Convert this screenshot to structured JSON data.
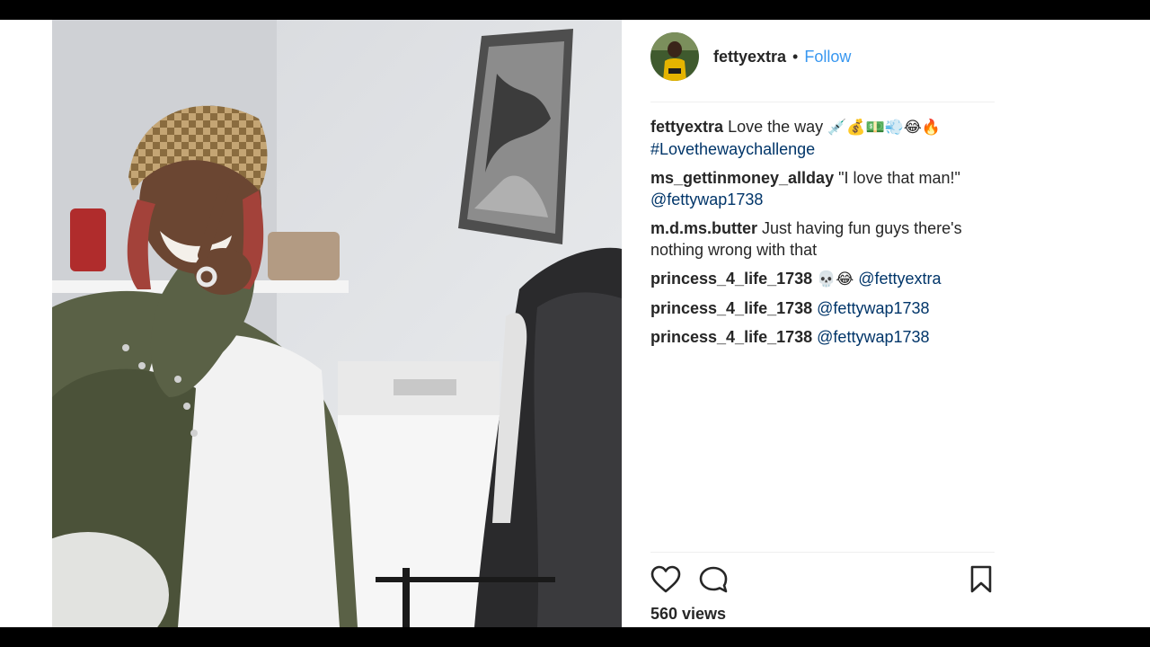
{
  "post": {
    "username": "fettyextra",
    "separator": "•",
    "follow_label": "Follow",
    "views": "560 views"
  },
  "comments": [
    {
      "user": "fettyextra",
      "text": "Love the way",
      "emoji": "💉💰💵💨😂🔥",
      "link": "#Lovethewaychallenge"
    },
    {
      "user": "ms_gettinmoney_allday",
      "text": "\"I love that man!\"",
      "link": "@fettywap1738"
    },
    {
      "user": "m.d.ms.butter",
      "text": "Just having fun guys there's nothing wrong with that"
    },
    {
      "user": "princess_4_life_1738",
      "emoji": "💀😂",
      "link": "@fettyextra"
    },
    {
      "user": "princess_4_life_1738",
      "link": "@fettywap1738"
    },
    {
      "user": "princess_4_life_1738",
      "link": "@fettywap1738"
    }
  ],
  "icons": {
    "like": "heart-icon",
    "comment": "comment-icon",
    "save": "bookmark-icon"
  },
  "colors": {
    "link": "#003569",
    "follow": "#3897f0",
    "text": "#262626",
    "letterbox": "#000000"
  }
}
